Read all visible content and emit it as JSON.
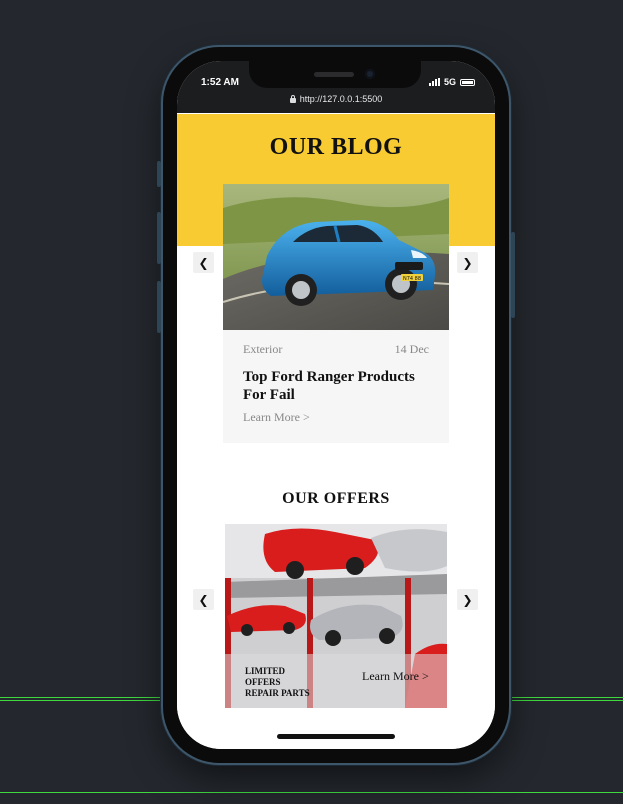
{
  "status_bar": {
    "time": "1:52 AM",
    "network": "5G",
    "url": "http://127.0.0.1:5500"
  },
  "blog": {
    "title": "OUR BLOG",
    "prev_icon": "chevron-left-icon",
    "next_icon": "chevron-right-icon",
    "prev_glyph": "❮",
    "next_glyph": "❯",
    "card": {
      "category": "Exterior",
      "date": "14 Dec",
      "headline": "Top Ford Ranger Products For Fail",
      "link": "Learn More >",
      "plate": "N74 88"
    }
  },
  "offers": {
    "title": "OUR OFFERS",
    "prev_glyph": "❮",
    "next_glyph": "❯",
    "card": {
      "labels": [
        "LIMITED",
        "OFFERS",
        "REPAIR PARTS"
      ],
      "link": "Learn More >"
    }
  },
  "colors": {
    "backdrop": "#24282e",
    "blog_band": "#f7cb31",
    "car_blue": "#1e7fc4",
    "car_red": "#d91c1c",
    "guide_green": "#3fd93f"
  }
}
